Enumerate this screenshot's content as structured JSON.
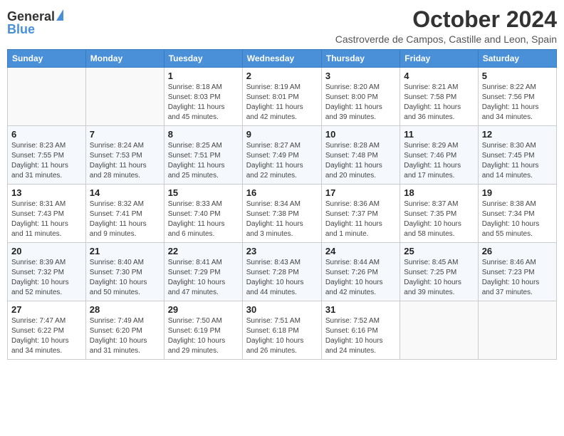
{
  "header": {
    "logo_general": "General",
    "logo_blue": "Blue",
    "month": "October 2024",
    "location": "Castroverde de Campos, Castille and Leon, Spain"
  },
  "weekdays": [
    "Sunday",
    "Monday",
    "Tuesday",
    "Wednesday",
    "Thursday",
    "Friday",
    "Saturday"
  ],
  "weeks": [
    [
      {
        "day": "",
        "sunrise": "",
        "sunset": "",
        "daylight": ""
      },
      {
        "day": "",
        "sunrise": "",
        "sunset": "",
        "daylight": ""
      },
      {
        "day": "1",
        "sunrise": "Sunrise: 8:18 AM",
        "sunset": "Sunset: 8:03 PM",
        "daylight": "Daylight: 11 hours and 45 minutes."
      },
      {
        "day": "2",
        "sunrise": "Sunrise: 8:19 AM",
        "sunset": "Sunset: 8:01 PM",
        "daylight": "Daylight: 11 hours and 42 minutes."
      },
      {
        "day": "3",
        "sunrise": "Sunrise: 8:20 AM",
        "sunset": "Sunset: 8:00 PM",
        "daylight": "Daylight: 11 hours and 39 minutes."
      },
      {
        "day": "4",
        "sunrise": "Sunrise: 8:21 AM",
        "sunset": "Sunset: 7:58 PM",
        "daylight": "Daylight: 11 hours and 36 minutes."
      },
      {
        "day": "5",
        "sunrise": "Sunrise: 8:22 AM",
        "sunset": "Sunset: 7:56 PM",
        "daylight": "Daylight: 11 hours and 34 minutes."
      }
    ],
    [
      {
        "day": "6",
        "sunrise": "Sunrise: 8:23 AM",
        "sunset": "Sunset: 7:55 PM",
        "daylight": "Daylight: 11 hours and 31 minutes."
      },
      {
        "day": "7",
        "sunrise": "Sunrise: 8:24 AM",
        "sunset": "Sunset: 7:53 PM",
        "daylight": "Daylight: 11 hours and 28 minutes."
      },
      {
        "day": "8",
        "sunrise": "Sunrise: 8:25 AM",
        "sunset": "Sunset: 7:51 PM",
        "daylight": "Daylight: 11 hours and 25 minutes."
      },
      {
        "day": "9",
        "sunrise": "Sunrise: 8:27 AM",
        "sunset": "Sunset: 7:49 PM",
        "daylight": "Daylight: 11 hours and 22 minutes."
      },
      {
        "day": "10",
        "sunrise": "Sunrise: 8:28 AM",
        "sunset": "Sunset: 7:48 PM",
        "daylight": "Daylight: 11 hours and 20 minutes."
      },
      {
        "day": "11",
        "sunrise": "Sunrise: 8:29 AM",
        "sunset": "Sunset: 7:46 PM",
        "daylight": "Daylight: 11 hours and 17 minutes."
      },
      {
        "day": "12",
        "sunrise": "Sunrise: 8:30 AM",
        "sunset": "Sunset: 7:45 PM",
        "daylight": "Daylight: 11 hours and 14 minutes."
      }
    ],
    [
      {
        "day": "13",
        "sunrise": "Sunrise: 8:31 AM",
        "sunset": "Sunset: 7:43 PM",
        "daylight": "Daylight: 11 hours and 11 minutes."
      },
      {
        "day": "14",
        "sunrise": "Sunrise: 8:32 AM",
        "sunset": "Sunset: 7:41 PM",
        "daylight": "Daylight: 11 hours and 9 minutes."
      },
      {
        "day": "15",
        "sunrise": "Sunrise: 8:33 AM",
        "sunset": "Sunset: 7:40 PM",
        "daylight": "Daylight: 11 hours and 6 minutes."
      },
      {
        "day": "16",
        "sunrise": "Sunrise: 8:34 AM",
        "sunset": "Sunset: 7:38 PM",
        "daylight": "Daylight: 11 hours and 3 minutes."
      },
      {
        "day": "17",
        "sunrise": "Sunrise: 8:36 AM",
        "sunset": "Sunset: 7:37 PM",
        "daylight": "Daylight: 11 hours and 1 minute."
      },
      {
        "day": "18",
        "sunrise": "Sunrise: 8:37 AM",
        "sunset": "Sunset: 7:35 PM",
        "daylight": "Daylight: 10 hours and 58 minutes."
      },
      {
        "day": "19",
        "sunrise": "Sunrise: 8:38 AM",
        "sunset": "Sunset: 7:34 PM",
        "daylight": "Daylight: 10 hours and 55 minutes."
      }
    ],
    [
      {
        "day": "20",
        "sunrise": "Sunrise: 8:39 AM",
        "sunset": "Sunset: 7:32 PM",
        "daylight": "Daylight: 10 hours and 52 minutes."
      },
      {
        "day": "21",
        "sunrise": "Sunrise: 8:40 AM",
        "sunset": "Sunset: 7:30 PM",
        "daylight": "Daylight: 10 hours and 50 minutes."
      },
      {
        "day": "22",
        "sunrise": "Sunrise: 8:41 AM",
        "sunset": "Sunset: 7:29 PM",
        "daylight": "Daylight: 10 hours and 47 minutes."
      },
      {
        "day": "23",
        "sunrise": "Sunrise: 8:43 AM",
        "sunset": "Sunset: 7:28 PM",
        "daylight": "Daylight: 10 hours and 44 minutes."
      },
      {
        "day": "24",
        "sunrise": "Sunrise: 8:44 AM",
        "sunset": "Sunset: 7:26 PM",
        "daylight": "Daylight: 10 hours and 42 minutes."
      },
      {
        "day": "25",
        "sunrise": "Sunrise: 8:45 AM",
        "sunset": "Sunset: 7:25 PM",
        "daylight": "Daylight: 10 hours and 39 minutes."
      },
      {
        "day": "26",
        "sunrise": "Sunrise: 8:46 AM",
        "sunset": "Sunset: 7:23 PM",
        "daylight": "Daylight: 10 hours and 37 minutes."
      }
    ],
    [
      {
        "day": "27",
        "sunrise": "Sunrise: 7:47 AM",
        "sunset": "Sunset: 6:22 PM",
        "daylight": "Daylight: 10 hours and 34 minutes."
      },
      {
        "day": "28",
        "sunrise": "Sunrise: 7:49 AM",
        "sunset": "Sunset: 6:20 PM",
        "daylight": "Daylight: 10 hours and 31 minutes."
      },
      {
        "day": "29",
        "sunrise": "Sunrise: 7:50 AM",
        "sunset": "Sunset: 6:19 PM",
        "daylight": "Daylight: 10 hours and 29 minutes."
      },
      {
        "day": "30",
        "sunrise": "Sunrise: 7:51 AM",
        "sunset": "Sunset: 6:18 PM",
        "daylight": "Daylight: 10 hours and 26 minutes."
      },
      {
        "day": "31",
        "sunrise": "Sunrise: 7:52 AM",
        "sunset": "Sunset: 6:16 PM",
        "daylight": "Daylight: 10 hours and 24 minutes."
      },
      {
        "day": "",
        "sunrise": "",
        "sunset": "",
        "daylight": ""
      },
      {
        "day": "",
        "sunrise": "",
        "sunset": "",
        "daylight": ""
      }
    ]
  ]
}
